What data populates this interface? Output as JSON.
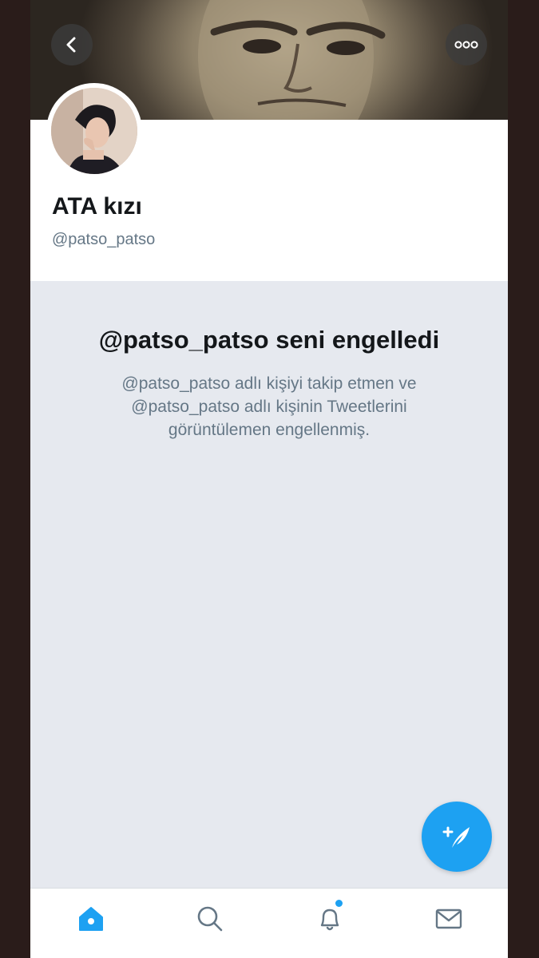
{
  "profile": {
    "display_name": "ATA kızı",
    "handle": "@patso_patso"
  },
  "blocked": {
    "title": "@patso_patso seni engelledi",
    "description": "@patso_patso adlı kişiyi takip etmen ve @patso_patso adlı kişinin Tweetlerini görüntülemen engellenmiş."
  },
  "icons": {
    "back": "chevron-left-icon",
    "more": "more-icon",
    "compose": "compose-tweet-icon",
    "home": "home-icon",
    "search": "search-icon",
    "notifications": "bell-icon",
    "messages": "mail-icon"
  },
  "tabs": [
    {
      "name": "home",
      "active": true
    },
    {
      "name": "search",
      "active": false
    },
    {
      "name": "notifications",
      "active": false,
      "has_badge": true
    },
    {
      "name": "messages",
      "active": false
    }
  ],
  "colors": {
    "accent": "#1da1f2",
    "text_primary": "#14171a",
    "text_secondary": "#657786",
    "background": "#e6e9ef"
  }
}
